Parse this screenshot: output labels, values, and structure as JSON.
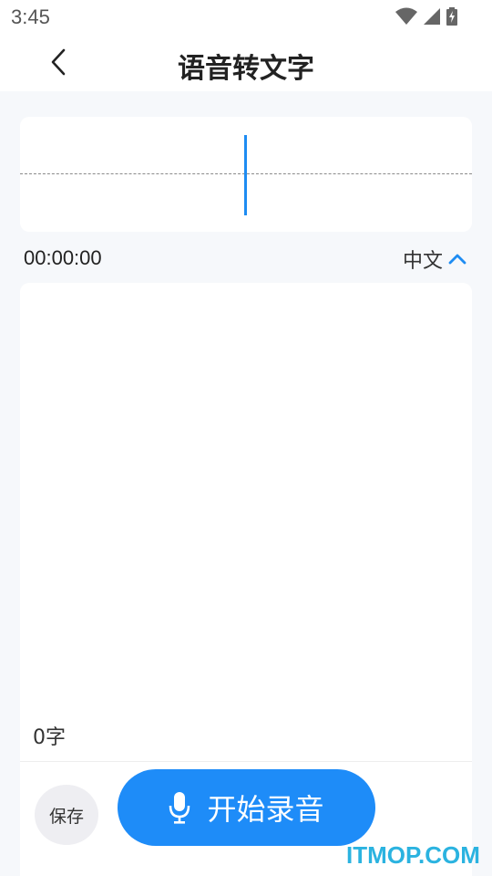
{
  "status_bar": {
    "time": "3:45",
    "icons": [
      "wifi-icon",
      "cellular-signal-icon",
      "battery-charging-icon"
    ]
  },
  "header": {
    "back_icon": "chevron-left-icon",
    "title": "语音转文字"
  },
  "waveform": {
    "accent_color": "#1e8cf2"
  },
  "recording": {
    "timer": "00:00:00",
    "language": "中文",
    "language_icon": "chevron-up-icon"
  },
  "editor": {
    "char_count": "0字"
  },
  "actions": {
    "save_label": "保存",
    "record_label": "开始录音",
    "record_icon": "microphone-icon",
    "record_color": "#1e8cf8"
  },
  "watermark": "ITMOP.COM"
}
